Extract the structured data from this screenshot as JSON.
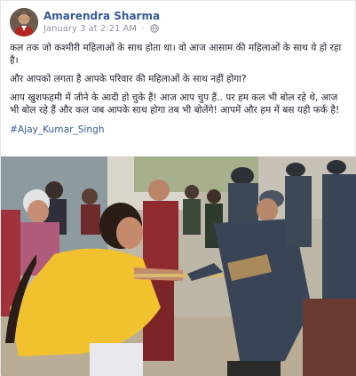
{
  "post": {
    "author": "Amarendra Sharma",
    "timestamp": "January 3 at 2:21 AM",
    "separator": "·",
    "privacy_icon": "globe-icon",
    "paragraphs": [
      "कल तक जो कश्मीरी महिलाओं के साथ होता था। वो आज आसाम की महिलाओं के साथ ये हो रहा है।",
      "और आपको लगता है आपके परिवार की महिलाओं के साथ नहीं होगा?",
      "आप खुशफहमी में जीने के आदी हो चुके हैं! आज आप चुप हैं.. पर हम कल भी बोल रहे थे, आज भी बोल रहे हैं और कल जब आपके साथ होगा तब भी बोलेंगे! आपमें और हम में बस यही फर्क है!"
    ],
    "hashtag": "#Ajay_Kumar_Singh",
    "photo_alt_icon": "news-photo"
  },
  "colors": {
    "link": "#385898",
    "meta": "#90949c",
    "text": "#1d2129"
  }
}
